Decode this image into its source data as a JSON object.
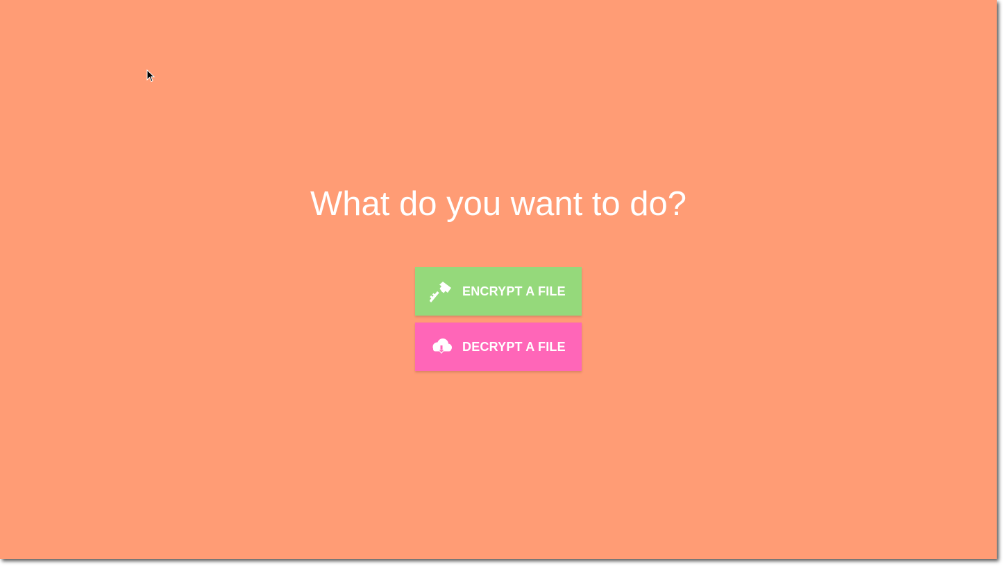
{
  "main": {
    "heading": "What do you want to do?",
    "buttons": [
      {
        "label": "ENCRYPT A FILE",
        "icon": "key-icon",
        "color": "#95d97b"
      },
      {
        "label": "DECRYPT A FILE",
        "icon": "cloud-download-icon",
        "color": "#ff66b8"
      }
    ]
  },
  "theme": {
    "background": "#ff9c75",
    "text": "#ffffff"
  }
}
